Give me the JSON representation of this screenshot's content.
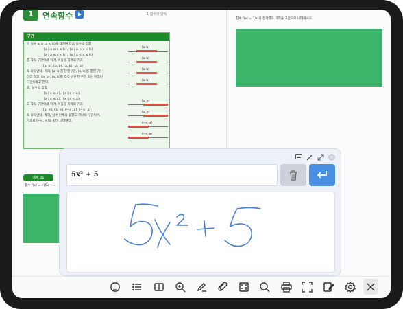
{
  "document": {
    "chapter_number": "1",
    "chapter_title": "연속함수",
    "header_right": "1 함수의 연속",
    "box_title": "구간",
    "box_lines": [
      "두 실수 a, b (a < b)에 대하여 다음 실수의 집합",
      "{x | a ≤ x ≤ b},  {x | a < x < b}",
      "{x | a ≤ x < b},  {x | a < x ≤ b}",
      "를 각각 구간이라 하며, 이들을 차례로 기호",
      "[a, b], (a, b), [a, b), (a, b]",
      "로 나타낸다. 이때, [a, b]를 닫힌구간, (a, b)를 열린구간",
      "이라 하고, [a, b), (a, b]를 각각 반닫힌 구간 또는 반열린",
      "구간이라고 한다.",
      "또, 실수의 집합",
      "{x | x ≥ a},  {x | x > a}",
      "{x | x ≤ a},  {x | x < a}",
      "도 각각 구간이라 하며, 이들을 차례로 기호",
      "[a, ∞), (a, ∞), (−∞, a], (−∞, a)",
      "로 나타낸다. 특히, 실수 전체의 집합도 하나의 구간이며,",
      "기호로 (−∞, ∞)와 같이 나타낸다."
    ],
    "intervals": [
      "[a, b]",
      "(a, b)",
      "[a, b)",
      "(a, b]",
      "[a, ∞)",
      "(a, ∞)",
      "(−∞, a]",
      "(−∞, a)"
    ],
    "example_tab": "예제 21",
    "example_text": "함수 f(x) = √(5x − ...",
    "right_text": "함수 f(x) = 1/x 의 정의역과 치역을 구간으로 나타내시오."
  },
  "handwriting_panel": {
    "recognized_text": "5x² + 5",
    "handwriting": "5x² + 5",
    "controls": [
      "keyboard-icon",
      "pen-icon",
      "expand-icon",
      "close-icon"
    ]
  },
  "toolbar": {
    "items": [
      "home-icon",
      "list-icon",
      "book-icon",
      "zoom-icon",
      "pen-icon",
      "attach-icon",
      "calculator-icon",
      "search-icon",
      "print-icon",
      "fullscreen-icon",
      "edit-icon",
      "settings-icon",
      "close-icon"
    ]
  },
  "colors": {
    "green": "#1f8a2a",
    "answer_box": "#3cb46a",
    "accent_blue": "#4a90e2",
    "ink": "#4a7fd4"
  }
}
